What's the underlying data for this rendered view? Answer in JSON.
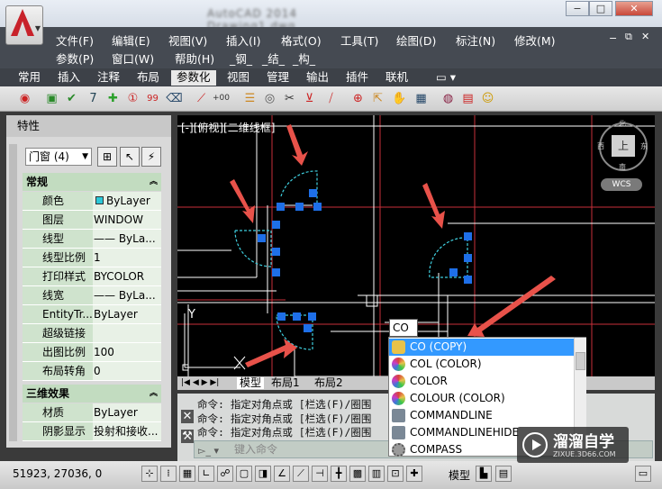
{
  "titlebar": {
    "title": "AutoCAD 2014   Drawing1.dwg"
  },
  "menus": [
    "文件(F)",
    "编辑(E)",
    "视图(V)",
    "插入(I)",
    "格式(O)",
    "工具(T)",
    "绘图(D)",
    "标注(N)",
    "修改(M)",
    "参数(P)",
    "窗口(W)",
    "帮助(H)",
    "_钢_",
    "_结_",
    "_构_"
  ],
  "ribbon_tabs": [
    "常用",
    "插入",
    "注释",
    "布局",
    "参数化",
    "视图",
    "管理",
    "输出",
    "插件",
    "联机"
  ],
  "active_tab": "参数化",
  "properties": {
    "title": "特性",
    "selection": "门窗 (4)",
    "sections": [
      {
        "name": "常规",
        "rows": [
          {
            "key": "颜色",
            "value": "ByLayer"
          },
          {
            "key": "图层",
            "value": "WINDOW"
          },
          {
            "key": "线型",
            "value": "—— ByLa..."
          },
          {
            "key": "线型比例",
            "value": "1"
          },
          {
            "key": "打印样式",
            "value": "BYCOLOR"
          },
          {
            "key": "线宽",
            "value": "—— ByLa..."
          },
          {
            "key": "EntityTr...",
            "value": "ByLayer"
          },
          {
            "key": "超级链接",
            "value": ""
          },
          {
            "key": "出图比例",
            "value": "100"
          },
          {
            "key": "布局转角",
            "value": "0"
          }
        ]
      },
      {
        "name": "三维效果",
        "rows": [
          {
            "key": "材质",
            "value": "ByLayer"
          },
          {
            "key": "阴影显示",
            "value": "投射和接收..."
          }
        ]
      }
    ]
  },
  "viewport": {
    "label": "[-][俯视][二维线框]",
    "viewcube": {
      "top": "上",
      "north": "北",
      "south": "南",
      "east": "东",
      "west": "西",
      "wcs": "WCS"
    }
  },
  "layout_tabs": [
    "模型",
    "布局1",
    "布局2"
  ],
  "command_history": [
    "命令: 指定对角点或 [栏选(F)/圈围",
    "命令: 指定对角点或 [栏选(F)/圈围",
    "命令: 指定对角点或 [栏选(F)/圈围"
  ],
  "command_placeholder": "键入命令",
  "autocomplete": {
    "typed": "CO",
    "items": [
      {
        "label": "CO (COPY)",
        "color": "#e8c24a"
      },
      {
        "label": "COL (COLOR)",
        "color": "#d8423c"
      },
      {
        "label": "COLOR",
        "color": "#d8423c"
      },
      {
        "label": "COLOUR (COLOR)",
        "color": "#d8423c"
      },
      {
        "label": "COMMANDLINE",
        "color": "#7a8896"
      },
      {
        "label": "COMMANDLINEHIDE",
        "color": "#7a8896"
      },
      {
        "label": "COMPASS",
        "color": "#8a8a8a"
      }
    ],
    "selected_index": 0
  },
  "status": {
    "coords": "51923, 27036, 0",
    "model": "模型"
  },
  "watermark": {
    "name": "溜溜自学",
    "url": "ZIXUE.3D66.COM"
  },
  "colors": {
    "accent": "#3399ff",
    "grip": "#1e6fe8",
    "arrow": "#e8524a",
    "wire": "#c8303a"
  }
}
